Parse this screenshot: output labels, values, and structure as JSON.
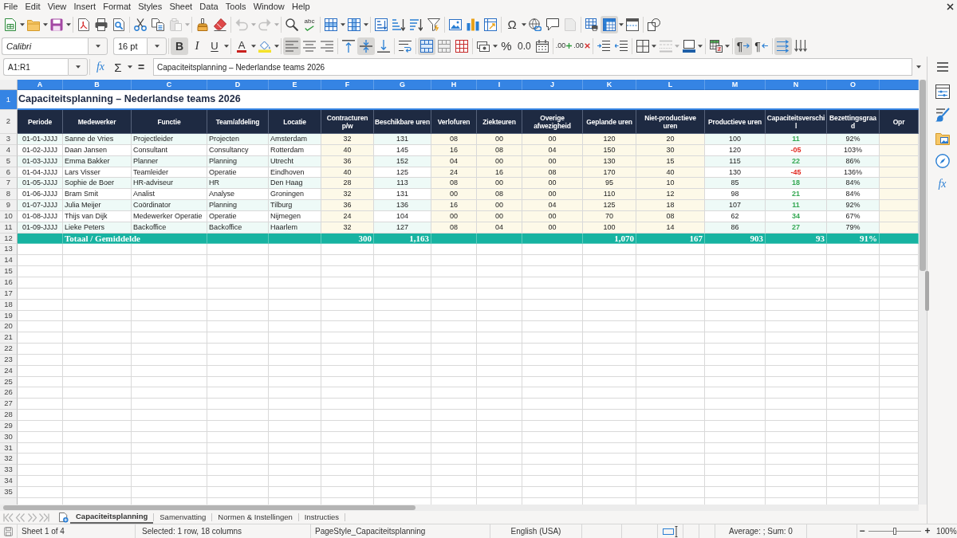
{
  "menu": [
    "File",
    "Edit",
    "View",
    "Insert",
    "Format",
    "Styles",
    "Sheet",
    "Data",
    "Tools",
    "Window",
    "Help"
  ],
  "standard_toolbar": {
    "groups": [
      [
        {
          "on": false,
          "disabled": false,
          "dropdown": true
        },
        {
          "on": false,
          "disabled": false,
          "dropdown": true
        },
        {
          "on": false,
          "disabled": false,
          "dropdown": true
        }
      ],
      [
        {
          "on": false,
          "disabled": false,
          "dropdown": false
        },
        {
          "on": false,
          "disabled": false,
          "dropdown": false
        },
        {
          "on": false,
          "disabled": false,
          "dropdown": false
        }
      ],
      [
        {
          "on": false,
          "disabled": false,
          "dropdown": false
        },
        {
          "on": false,
          "disabled": false,
          "dropdown": false
        },
        {
          "on": false,
          "disabled": true,
          "dropdown": true
        }
      ],
      [
        {
          "on": false,
          "disabled": false,
          "dropdown": false
        },
        {
          "on": false,
          "disabled": false,
          "dropdown": false
        }
      ],
      [
        {
          "on": false,
          "disabled": true,
          "dropdown": true
        },
        {
          "on": false,
          "disabled": true,
          "dropdown": true
        }
      ],
      [
        {
          "on": false,
          "disabled": false,
          "dropdown": false
        },
        {
          "glyph": "abc",
          "on": false,
          "disabled": false,
          "dropdown": false
        }
      ],
      [
        {
          "on": false,
          "disabled": false,
          "dropdown": true
        },
        {
          "on": false,
          "disabled": false,
          "dropdown": true
        }
      ],
      [
        {
          "on": false,
          "disabled": false,
          "dropdown": false
        },
        {
          "on": false,
          "disabled": false,
          "dropdown": false
        },
        {
          "on": false,
          "disabled": false,
          "dropdown": false
        },
        {
          "on": false,
          "disabled": false,
          "dropdown": false
        }
      ],
      [
        {
          "on": false,
          "disabled": false,
          "dropdown": false
        },
        {
          "on": false,
          "disabled": false,
          "dropdown": false
        },
        {
          "on": false,
          "disabled": false,
          "dropdown": false
        }
      ],
      [
        {
          "glyph": "Ω",
          "on": false,
          "disabled": false,
          "dropdown": true
        },
        {
          "on": false,
          "disabled": false,
          "dropdown": false
        },
        {
          "on": false,
          "disabled": false,
          "dropdown": false
        },
        {
          "on": false,
          "disabled": true,
          "dropdown": false
        }
      ],
      [
        {
          "on": false,
          "disabled": false,
          "dropdown": false
        },
        {
          "on": true,
          "disabled": false,
          "dropdown": true
        },
        {
          "on": false,
          "disabled": false,
          "dropdown": false
        }
      ],
      [
        {
          "on": false,
          "disabled": false,
          "dropdown": false
        }
      ]
    ]
  },
  "formatting_toolbar": {
    "font_name": "Calibri",
    "font_size": "16 pt",
    "groups": [
      [
        {
          "glyph": "B",
          "on": true,
          "disabled": false,
          "dropdown": false
        },
        {
          "glyph": "I",
          "on": false,
          "disabled": false,
          "dropdown": false
        },
        {
          "glyph": "U",
          "on": false,
          "disabled": false,
          "dropdown": true
        }
      ],
      [
        {
          "glyph": "A",
          "on": false,
          "disabled": false,
          "dropdown": true
        },
        {
          "on": false,
          "disabled": false,
          "dropdown": true
        }
      ],
      [
        {
          "on": true,
          "disabled": false,
          "dropdown": false
        },
        {
          "on": false,
          "disabled": false,
          "dropdown": false
        },
        {
          "on": false,
          "disabled": false,
          "dropdown": false
        }
      ],
      [
        {
          "on": false,
          "disabled": false,
          "dropdown": false
        },
        {
          "on": true,
          "disabled": false,
          "dropdown": false
        },
        {
          "on": false,
          "disabled": false,
          "dropdown": false
        }
      ],
      [
        {
          "on": false,
          "disabled": false,
          "dropdown": false
        }
      ],
      [
        {
          "on": true,
          "disabled": false,
          "dropdown": false
        },
        {
          "on": false,
          "disabled": false,
          "dropdown": false
        },
        {
          "on": false,
          "disabled": false,
          "dropdown": false
        }
      ],
      [
        {
          "on": false,
          "disabled": false,
          "dropdown": true
        },
        {
          "glyph": "%",
          "on": false,
          "disabled": false,
          "dropdown": false
        },
        {
          "glyph": "0.0",
          "on": false,
          "disabled": false,
          "dropdown": false
        },
        {
          "on": false,
          "disabled": false,
          "dropdown": false
        }
      ],
      [
        {
          "glyph": ".00",
          "on": false,
          "disabled": false,
          "dropdown": false
        },
        {
          "glyph": ".00",
          "on": false,
          "disabled": false,
          "dropdown": false
        }
      ],
      [
        {
          "on": false,
          "disabled": false,
          "dropdown": false
        },
        {
          "on": false,
          "disabled": false,
          "dropdown": false
        }
      ],
      [
        {
          "on": false,
          "disabled": false,
          "dropdown": true
        },
        {
          "on": false,
          "disabled": true,
          "dropdown": true
        },
        {
          "on": false,
          "disabled": false,
          "dropdown": true
        }
      ],
      [
        {
          "on": false,
          "disabled": false,
          "dropdown": true
        }
      ],
      [
        {
          "glyph": "¶",
          "on": true,
          "disabled": false,
          "dropdown": false
        },
        {
          "glyph": "¶",
          "on": false,
          "disabled": false,
          "dropdown": false
        }
      ],
      [
        {
          "on": true,
          "disabled": false,
          "dropdown": false
        },
        {
          "on": false,
          "disabled": false,
          "dropdown": false
        }
      ]
    ]
  },
  "formula_bar": {
    "name_box": "A1:R1",
    "function_wizard": "fx",
    "sum": "Σ",
    "equals": "=",
    "content": "Capaciteitsplanning – Nederlandse teams 2026"
  },
  "sidebar": {
    "tabs": [
      {
        "selected": false
      },
      {
        "selected": false
      },
      {
        "selected": false
      },
      {
        "selected": false
      },
      {
        "glyph": "fx",
        "selected": false
      }
    ]
  },
  "sheet": {
    "columns": [
      {
        "letter": "A",
        "kind": "calc",
        "selected": true
      },
      {
        "letter": "B",
        "kind": "calc",
        "selected": true
      },
      {
        "letter": "C",
        "kind": "calc",
        "selected": true
      },
      {
        "letter": "D",
        "kind": "calc",
        "selected": true
      },
      {
        "letter": "E",
        "kind": "calc",
        "selected": true
      },
      {
        "letter": "F",
        "kind": "input",
        "selected": true
      },
      {
        "letter": "G",
        "kind": "calc",
        "selected": true
      },
      {
        "letter": "H",
        "kind": "input",
        "selected": true
      },
      {
        "letter": "I",
        "kind": "input",
        "selected": true
      },
      {
        "letter": "J",
        "kind": "input",
        "selected": true
      },
      {
        "letter": "K",
        "kind": "input",
        "selected": true
      },
      {
        "letter": "L",
        "kind": "input",
        "selected": true
      },
      {
        "letter": "M",
        "kind": "calc",
        "selected": true
      },
      {
        "letter": "N",
        "kind": "calc",
        "selected": true
      },
      {
        "letter": "O",
        "kind": "calc",
        "selected": true
      },
      {
        "kind": "input",
        "selected": true
      }
    ],
    "title_row": {
      "number": "1",
      "selected": true,
      "title": "Capaciteitsplanning – Nederlandse teams 2026"
    },
    "header_row": {
      "number": "2",
      "selected": false,
      "cells": [
        "Periode",
        "Medewerker",
        "Functie",
        "Team/afdeling",
        "Locatie",
        "Contracturen p/w",
        "Beschikbare uren",
        "Verlofuren",
        "Ziekteuren",
        "Overige afwezigheid",
        "Geplande uren",
        "Niet-productieve uren",
        "Productieve uren",
        "Capaciteitsverschil",
        "Bezettingsgraad",
        "Opr"
      ]
    },
    "rows": [
      {
        "number": "3",
        "selected": false,
        "cells": [
          "01-01-JJJJ",
          "Sanne de Vries",
          "Projectleider",
          "Projecten",
          "Amsterdam",
          "32",
          "131",
          "08",
          "00",
          "00",
          "120",
          "20",
          "100",
          {
            "text": "11",
            "color": "#34a853"
          },
          "92%"
        ]
      },
      {
        "number": "4",
        "selected": false,
        "cells": [
          "01-02-JJJJ",
          "Daan Jansen",
          "Consultant",
          "Consultancy",
          "Rotterdam",
          "40",
          "145",
          "16",
          "08",
          "04",
          "150",
          "30",
          "120",
          {
            "text": "-05",
            "color": "#e0271f"
          },
          "103%"
        ]
      },
      {
        "number": "5",
        "selected": false,
        "cells": [
          "01-03-JJJJ",
          "Emma Bakker",
          "Planner",
          "Planning",
          "Utrecht",
          "36",
          "152",
          "04",
          "00",
          "00",
          "130",
          "15",
          "115",
          {
            "text": "22",
            "color": "#34a853"
          },
          "86%"
        ]
      },
      {
        "number": "6",
        "selected": false,
        "cells": [
          "01-04-JJJJ",
          "Lars Visser",
          "Teamleider",
          "Operatie",
          "Eindhoven",
          "40",
          "125",
          "24",
          "16",
          "08",
          "170",
          "40",
          "130",
          {
            "text": "-45",
            "color": "#e0271f"
          },
          "136%"
        ]
      },
      {
        "number": "7",
        "selected": false,
        "cells": [
          "01-05-JJJJ",
          "Sophie de Boer",
          "HR-adviseur",
          "HR",
          "Den Haag",
          "28",
          "113",
          "08",
          "00",
          "00",
          "95",
          "10",
          "85",
          {
            "text": "18",
            "color": "#34a853"
          },
          "84%"
        ]
      },
      {
        "number": "8",
        "selected": false,
        "cells": [
          "01-06-JJJJ",
          "Bram Smit",
          "Analist",
          "Analyse",
          "Groningen",
          "32",
          "131",
          "00",
          "08",
          "00",
          "110",
          "12",
          "98",
          {
            "text": "21",
            "color": "#34a853"
          },
          "84%"
        ]
      },
      {
        "number": "9",
        "selected": false,
        "cells": [
          "01-07-JJJJ",
          "Julia Meijer",
          "Coördinator",
          "Planning",
          "Tilburg",
          "36",
          "136",
          "16",
          "00",
          "04",
          "125",
          "18",
          "107",
          {
            "text": "11",
            "color": "#34a853"
          },
          "92%"
        ]
      },
      {
        "number": "10",
        "selected": false,
        "cells": [
          "01-08-JJJJ",
          "Thijs van Dijk",
          "Medewerker Operatie",
          "Operatie",
          "Nijmegen",
          "24",
          "104",
          "00",
          "00",
          "00",
          "70",
          "08",
          "62",
          {
            "text": "34",
            "color": "#34a853"
          },
          "67%"
        ]
      },
      {
        "number": "11",
        "selected": false,
        "cells": [
          "01-09-JJJJ",
          "Lieke Peters",
          "Backoffice",
          "Backoffice",
          "Haarlem",
          "32",
          "127",
          "08",
          "04",
          "00",
          "100",
          "14",
          "86",
          {
            "text": "27",
            "color": "#34a853"
          },
          "79%"
        ]
      }
    ],
    "total_row": {
      "number": "12",
      "selected": false,
      "cells": [
        null,
        "Totaal / Gemiddelde",
        null,
        null,
        null,
        "300",
        "1,163",
        null,
        null,
        null,
        "1,070",
        "167",
        "903",
        "93",
        "91%"
      ]
    },
    "empty_rows": [
      {
        "number": "13",
        "selected": false
      },
      {
        "number": "14",
        "selected": false
      },
      {
        "number": "15",
        "selected": false
      },
      {
        "number": "16",
        "selected": false
      },
      {
        "number": "17",
        "selected": false
      },
      {
        "number": "18",
        "selected": false
      },
      {
        "number": "19",
        "selected": false
      },
      {
        "number": "20",
        "selected": false
      },
      {
        "number": "21",
        "selected": false
      },
      {
        "number": "22",
        "selected": false
      },
      {
        "number": "23",
        "selected": false
      },
      {
        "number": "24",
        "selected": false
      },
      {
        "number": "25",
        "selected": false
      },
      {
        "number": "26",
        "selected": false
      },
      {
        "number": "27",
        "selected": false
      },
      {
        "number": "28",
        "selected": false
      },
      {
        "number": "29",
        "selected": false
      },
      {
        "number": "30",
        "selected": false
      },
      {
        "number": "31",
        "selected": false
      },
      {
        "number": "32",
        "selected": false
      },
      {
        "number": "33",
        "selected": false
      },
      {
        "number": "34",
        "selected": false
      },
      {
        "number": "35",
        "selected": false
      }
    ]
  },
  "sheet_navigation": {
    "disabled": true
  },
  "sheet_tabs": [
    {
      "label": "Capaciteitsplanning",
      "selected": true
    },
    {
      "label": "Samenvatting",
      "selected": false
    },
    {
      "label": "Normen & Instellingen",
      "selected": false
    },
    {
      "label": "Instructies",
      "selected": false
    }
  ],
  "status_bar": {
    "sheet": "Sheet 1 of 4",
    "selection": "Selected: 1 row, 18 columns",
    "page_style": "PageStyle_Capaciteitsplanning",
    "language": "English (USA)",
    "statistics": "Average: ; Sum: 0",
    "zoom_out": "−",
    "zoom_slider": {
      "level": 0.5
    },
    "zoom_in": "+",
    "zoom": "100%"
  }
}
